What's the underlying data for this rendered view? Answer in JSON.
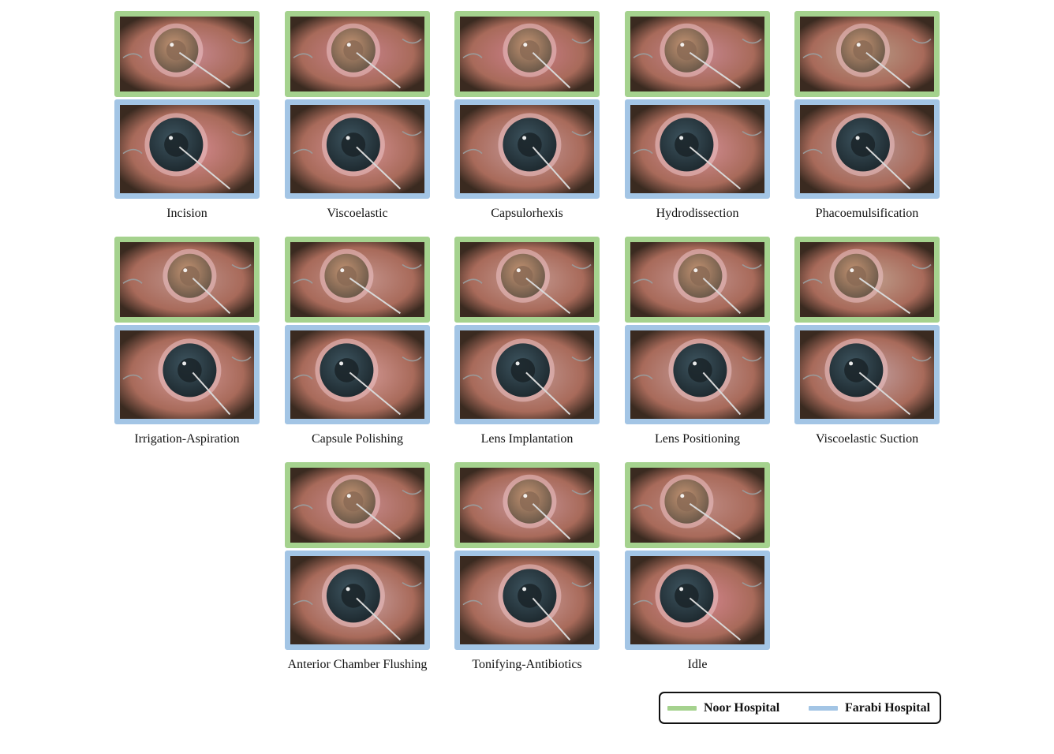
{
  "colors": {
    "noor": "#a5d28e",
    "farabi": "#a3c5e5"
  },
  "phases": [
    {
      "label": "Incision",
      "noor_tone": "#c98a93",
      "farabi_tone": "#d88c93"
    },
    {
      "label": "Viscoelastic",
      "noor_tone": "#c9838c",
      "farabi_tone": "#d89497"
    },
    {
      "label": "Capsulorhexis",
      "noor_tone": "#cc7f8a",
      "farabi_tone": "#c79a9a"
    },
    {
      "label": "Hydrodissection",
      "noor_tone": "#c88791",
      "farabi_tone": "#d48f96"
    },
    {
      "label": "Phacoemulsification",
      "noor_tone": "#b89a86",
      "farabi_tone": "#b99a98"
    },
    {
      "label": "Irrigation-Aspiration",
      "noor_tone": "#c0948d",
      "farabi_tone": "#d49a98"
    },
    {
      "label": "Capsule Polishing",
      "noor_tone": "#c6968f",
      "farabi_tone": "#d69c99"
    },
    {
      "label": "Lens Implantation",
      "noor_tone": "#c69b93",
      "farabi_tone": "#c49a95"
    },
    {
      "label": "Lens Positioning",
      "noor_tone": "#c59591",
      "farabi_tone": "#c69d9a"
    },
    {
      "label": "Viscoelastic Suction",
      "noor_tone": "#c0a08e",
      "farabi_tone": "#c3a1a2"
    },
    {
      "label": "Anterior Chamber Flushing",
      "noor_tone": "#c98c90",
      "farabi_tone": "#cda4a5"
    },
    {
      "label": "Tonifying-Antibiotics",
      "noor_tone": "#c9969a",
      "farabi_tone": "#cfa1a0"
    },
    {
      "label": "Idle",
      "noor_tone": "#c08d86",
      "farabi_tone": "#d5868f"
    }
  ],
  "legend": {
    "noor": "Noor Hospital",
    "farabi": "Farabi Hospital"
  }
}
